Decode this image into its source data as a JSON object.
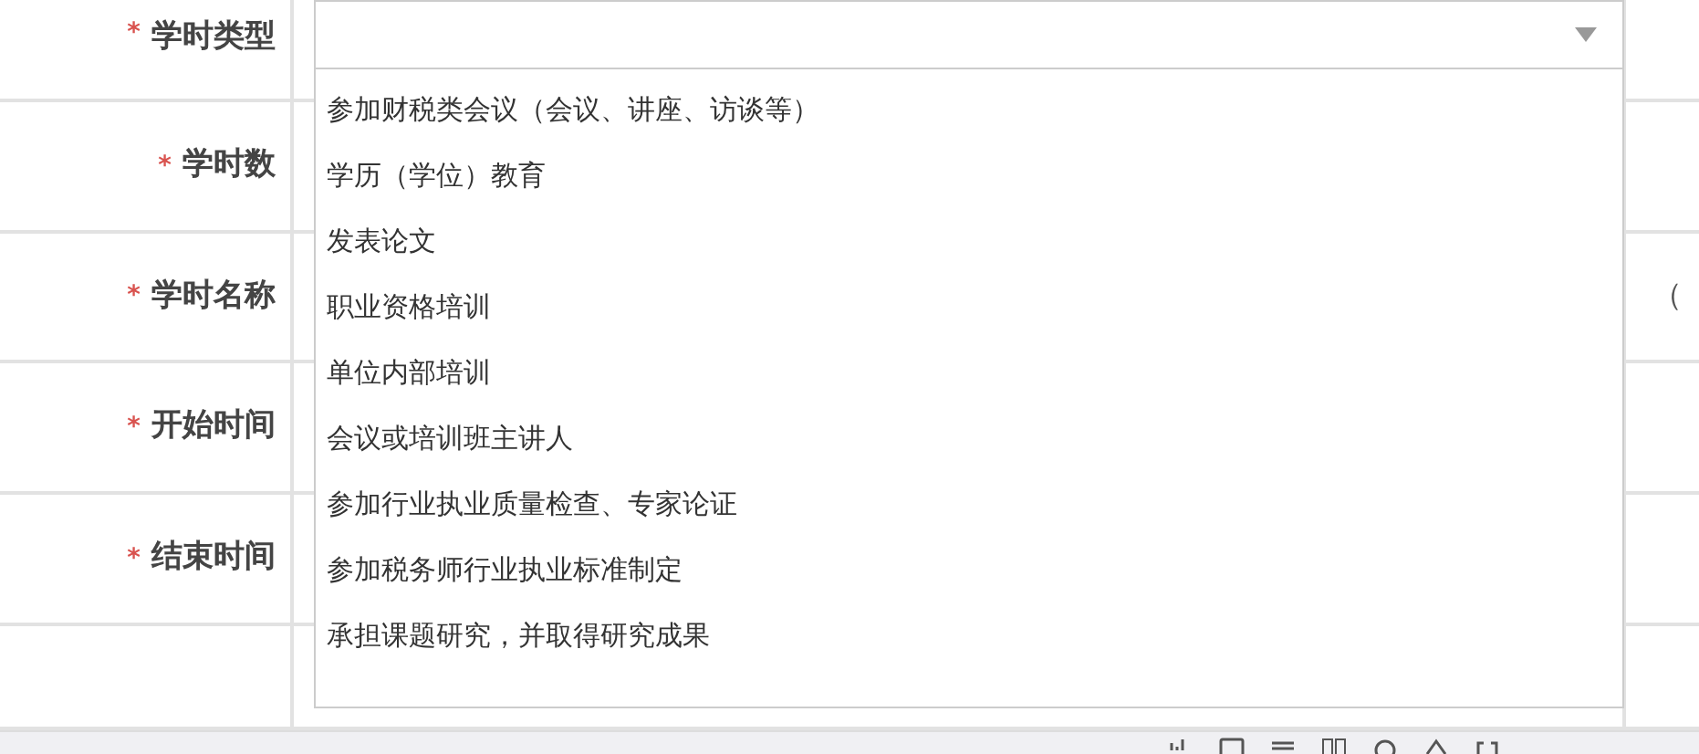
{
  "form": {
    "rows": [
      {
        "label": "学时类型",
        "marker": "*"
      },
      {
        "label": "学时数",
        "marker": "*"
      },
      {
        "label": "学时名称",
        "marker": "*"
      },
      {
        "label": "开始时间",
        "marker": "*"
      },
      {
        "label": "结束时间",
        "marker": "*"
      }
    ]
  },
  "select": {
    "expanded": true,
    "options": [
      "参加财税类会议（会议、讲座、访谈等）",
      "学历（学位）教育",
      "发表论文",
      "职业资格培训",
      "单位内部培训",
      "会议或培训班主讲人",
      "参加行业执业质量检查、专家论证",
      "参加税务师行业执业标准制定",
      "承担课题研究，并取得研究成果"
    ]
  },
  "side_text": "（"
}
